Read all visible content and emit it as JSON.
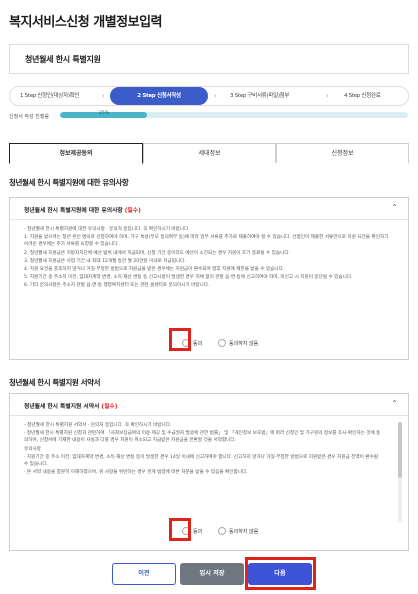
{
  "page": {
    "title": "복지서비스신청 개별정보입력"
  },
  "service": {
    "name": "청년월세 한시 특별지원"
  },
  "steps": [
    {
      "label": "1 Step 신청인(대상자)확인"
    },
    {
      "label": "2 Step 신청서작성"
    },
    {
      "label": "3 Step 구비서류(파일)첨부"
    },
    {
      "label": "4 Step 신청완료"
    }
  ],
  "progress": {
    "label": "신청서 작성 진행률",
    "percent": 25,
    "percent_text": "25%"
  },
  "tabs": [
    {
      "label": "정보제공동의"
    },
    {
      "label": "세대정보"
    },
    {
      "label": "신청정보"
    }
  ],
  "section1": {
    "title": "청년월세 한시 특별지원에 대한 유의사항",
    "box_title": "청년월세 한시 특별지원에 대한 유의사항",
    "required": "(필수)",
    "paragraphs": [
      "- 청년월세 한시 특별지원에 대한 유의사항 · 문의처 등입니다. 꼭 확인하시기 바랍니다.",
      "1. 지원을 받으려는 청년 본인 명의로 신청하여야 하며, 가구 특성(부모 동의여부 등)에 따라 일부 서류를 추가로 제출하여야 할 수 있습니다. 신청인이 제출한 서류만으로 지원 요건을 확인하기 어려운 경우에는 추가 서류를 요청할 수 있습니다.",
      "2. 청년월세 지원금은 지방자치단체 예산 범위 내에서 지급되며, 신청 기간 중이라도 예산이 소진되는 경우 지원이 조기 종료될 수 있습니다.",
      "3. 청년월세 지원금은 사업 기간 내 최대 12개월 동안 월 20만원 이내로 지급됩니다.",
      "4. 지원 요건을 충족하지 않거나 거짓·부정한 방법으로 지원금을 받은 경우에는 지원금이 환수되며 향후 지원에 제한을 받을 수 있습니다.",
      "5. 지원기간 중 주소지 이전, 임대차계약 변경, 소득·재산 변동 등 신고사항이 발생한 경우 지체 없이 관할 읍·면·동에 신고하여야 하며, 미신고 시 지원이 중단될 수 있습니다.",
      "6. 기타 문의사항은 주소지 관할 읍·면·동 행정복지센터 또는 관련 콜센터로 문의하시기 바랍니다."
    ],
    "agree": "동의",
    "disagree": "동의하지 않음"
  },
  "section2": {
    "title": "청년월세 한시 특별지원 서약서",
    "box_title": "청년월세 한시 특별지원 서약서",
    "required": "(필수)",
    "paragraphs": [
      "- 청년월세 한시 특별지원 서약서 · 문의처 등입니다. 꼭 확인하시기 바랍니다.",
      "· 청년월세 한시 특별지원 신청과 관련하여 「사회보장급여의 이용·제공 및 수급권자 발굴에 관한 법률」 및 「개인정보 보호법」에 따라 신청인 및 가구원의 정보를 조사·확인하는 것에 동의하며, 신청서에 기재한 내용이 사실과 다를 경우 지원이 취소되고 지급받은 지원금을 반환할 것을 서약합니다.",
      "유의사항",
      "· 지원기간 중 주소 이전, 임대차계약 변경, 소득·재산 변동 등이 발생한 경우 14일 이내에 신고하여야 합니다. 신고하지 않거나 거짓·부정한 방법으로 지원받은 경우 지원금 전액이 환수될 수 있습니다.",
      "· 본 서약 내용을 충분히 이해하였으며, 위 사항을 위반하는 경우 관계 법령에 따른 처분을 받을 수 있음을 확인합니다."
    ],
    "agree": "동의",
    "disagree": "동의하지 않음"
  },
  "buttons": {
    "prev": "이전",
    "temp_save": "임시 저장",
    "next": "다음"
  },
  "colors": {
    "accent": "#3b5cc9",
    "progress": "#4bb4c8",
    "highlight": "#e2231a",
    "temp_button": "#6f7680"
  }
}
